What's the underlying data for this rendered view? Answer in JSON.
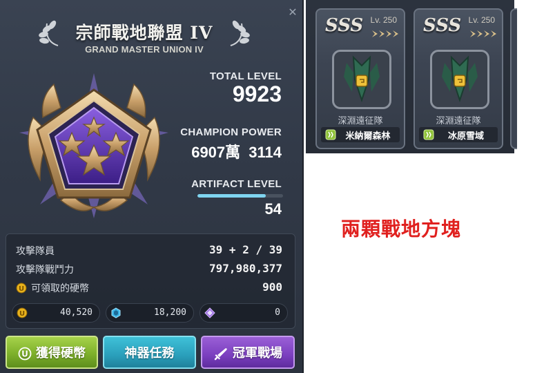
{
  "union": {
    "title": "宗師戰地聯盟 IV",
    "subtitle": "GRAND MASTER UNION IV",
    "total_level_caption": "TOTAL LEVEL",
    "total_level": "9923",
    "champion_power_caption": "CHAMPION POWER",
    "champion_power": "6907萬 3114",
    "artifact_level_caption": "ARTIFACT LEVEL",
    "artifact_level": "54",
    "artifact_level_progress": 0.8,
    "close_icon": "close-icon",
    "emblem_icon": "three-star-pentagon-medal"
  },
  "stats": {
    "members_label": "攻擊隊員",
    "members_value": "39 + 2 / 39",
    "power_label": "攻擊隊戰鬥力",
    "power_value": "797,980,377",
    "claimable_coins_label": "可領取的硬幣",
    "claimable_coins_value": "900"
  },
  "currencies": {
    "coins": "40,520",
    "crystals": "18,200",
    "gems": "0"
  },
  "buttons": {
    "earn_coins": "獲得硬幣",
    "artifact_quest": "神器任務",
    "champion_arena": "冠軍戰場"
  },
  "cards": [
    {
      "rank": "SSS",
      "level": "Lv. 250",
      "name": "深淵遠征隊",
      "region": "米納爾森林"
    },
    {
      "rank": "SSS",
      "level": "Lv. 250",
      "name": "深淵遠征隊",
      "region": "冰原雪域"
    }
  ],
  "caption": "兩顆戰地方塊",
  "colors": {
    "accent_green": "#8fc13a",
    "accent_cyan": "#2fb0c9",
    "accent_purple": "#8a4fcb",
    "caption_red": "#e0201e",
    "coin_gold": "#e8b21c"
  }
}
